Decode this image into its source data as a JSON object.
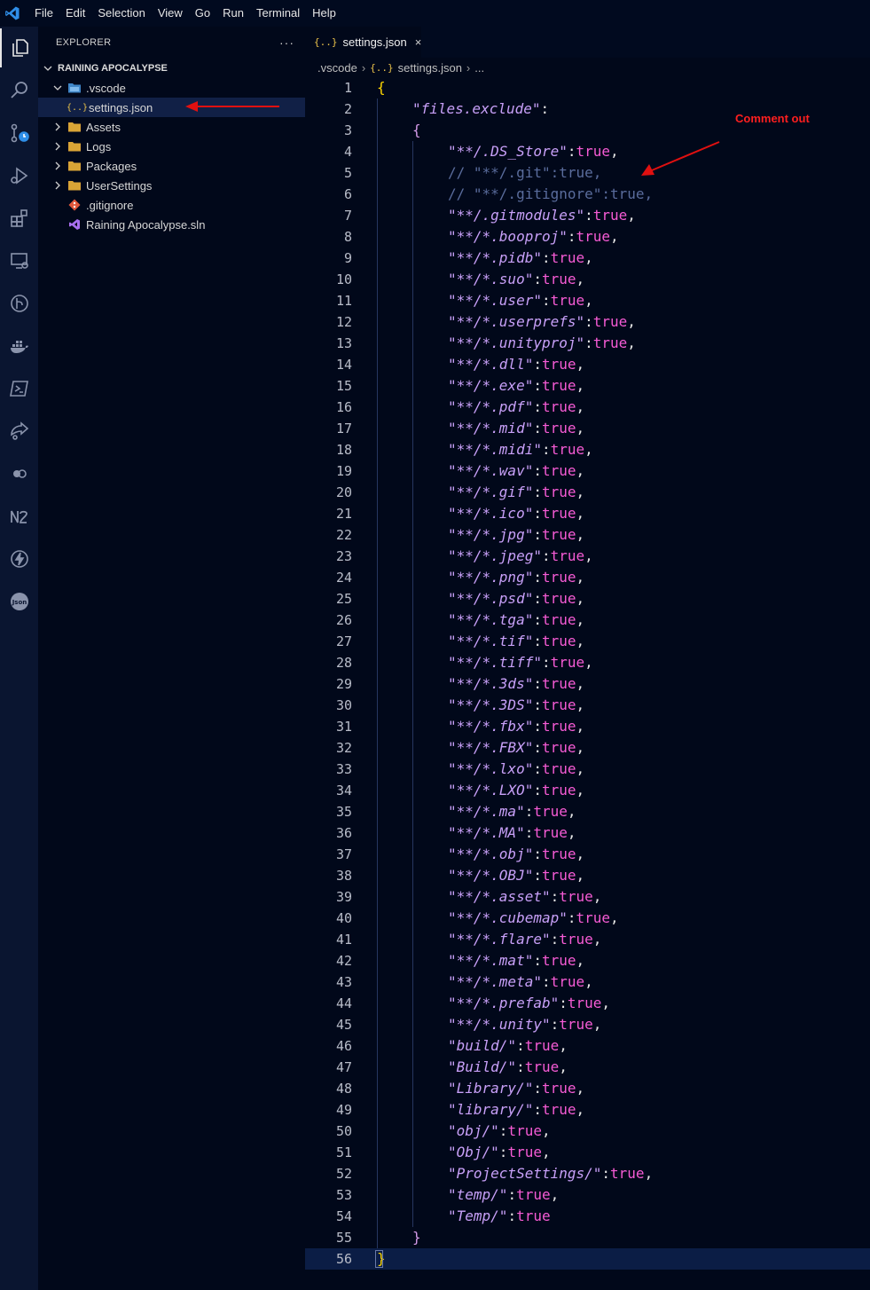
{
  "menu": [
    "File",
    "Edit",
    "Selection",
    "View",
    "Go",
    "Run",
    "Terminal",
    "Help"
  ],
  "activity_icons": [
    "explorer-icon",
    "search-icon",
    "source-control-icon",
    "run-debug-icon",
    "extensions-icon",
    "remote-explorer-icon",
    "git-graph-icon",
    "docker-icon",
    "powershell-icon",
    "live-share-icon",
    "toggle-icon",
    "n2-icon",
    "thunder-client-icon",
    "json-icon"
  ],
  "sidebar": {
    "title": "EXPLORER",
    "more": "···",
    "project": "RAINING APOCALYPSE",
    "tree": [
      {
        "label": ".vscode",
        "type": "folder-open",
        "depth": 1
      },
      {
        "label": "settings.json",
        "type": "json",
        "depth": 2,
        "selected": true
      },
      {
        "label": "Assets",
        "type": "folder",
        "depth": 1
      },
      {
        "label": "Logs",
        "type": "folder",
        "depth": 1
      },
      {
        "label": "Packages",
        "type": "folder",
        "depth": 1
      },
      {
        "label": "UserSettings",
        "type": "folder",
        "depth": 1
      },
      {
        "label": ".gitignore",
        "type": "git",
        "depth": 1
      },
      {
        "label": "Raining Apocalypse.sln",
        "type": "sln",
        "depth": 1
      }
    ]
  },
  "tab": {
    "icon": "{..}",
    "label": "settings.json",
    "close": "×"
  },
  "breadcrumb": [
    ".vscode",
    "settings.json",
    "..."
  ],
  "annotation": {
    "label": "Comment out",
    "color": "#ff1f1f"
  },
  "colors": {
    "key": "#c8a0f8",
    "value": "#f65bd5",
    "comment": "#5a6c9c",
    "bracket": "#ffd700",
    "background": "#01081a"
  },
  "editor": {
    "current_line": 56,
    "lines": [
      {
        "t": "obrace",
        "text": "{"
      },
      {
        "t": "key",
        "indent": 1,
        "key": "\"files.exclude\"",
        "suffix": ":"
      },
      {
        "t": "brace",
        "indent": 1,
        "text": "{"
      },
      {
        "t": "entry",
        "key": "\"**/.DS_Store\"",
        "val": "true",
        "comma": ","
      },
      {
        "t": "comment",
        "text": "// \"**/.git\":true,"
      },
      {
        "t": "comment",
        "text": "// \"**/.gitignore\":true,"
      },
      {
        "t": "entry",
        "key": "\"**/.gitmodules\"",
        "val": "true",
        "comma": ","
      },
      {
        "t": "entry",
        "key": "\"**/*.booproj\"",
        "val": "true",
        "comma": ","
      },
      {
        "t": "entry",
        "key": "\"**/*.pidb\"",
        "val": "true",
        "comma": ","
      },
      {
        "t": "entry",
        "key": "\"**/*.suo\"",
        "val": "true",
        "comma": ","
      },
      {
        "t": "entry",
        "key": "\"**/*.user\"",
        "val": "true",
        "comma": ","
      },
      {
        "t": "entry",
        "key": "\"**/*.userprefs\"",
        "val": "true",
        "comma": ","
      },
      {
        "t": "entry",
        "key": "\"**/*.unityproj\"",
        "val": "true",
        "comma": ","
      },
      {
        "t": "entry",
        "key": "\"**/*.dll\"",
        "val": "true",
        "comma": ","
      },
      {
        "t": "entry",
        "key": "\"**/*.exe\"",
        "val": "true",
        "comma": ","
      },
      {
        "t": "entry",
        "key": "\"**/*.pdf\"",
        "val": "true",
        "comma": ","
      },
      {
        "t": "entry",
        "key": "\"**/*.mid\"",
        "val": "true",
        "comma": ","
      },
      {
        "t": "entry",
        "key": "\"**/*.midi\"",
        "val": "true",
        "comma": ","
      },
      {
        "t": "entry",
        "key": "\"**/*.wav\"",
        "val": "true",
        "comma": ","
      },
      {
        "t": "entry",
        "key": "\"**/*.gif\"",
        "val": "true",
        "comma": ","
      },
      {
        "t": "entry",
        "key": "\"**/*.ico\"",
        "val": "true",
        "comma": ","
      },
      {
        "t": "entry",
        "key": "\"**/*.jpg\"",
        "val": "true",
        "comma": ","
      },
      {
        "t": "entry",
        "key": "\"**/*.jpeg\"",
        "val": "true",
        "comma": ","
      },
      {
        "t": "entry",
        "key": "\"**/*.png\"",
        "val": "true",
        "comma": ","
      },
      {
        "t": "entry",
        "key": "\"**/*.psd\"",
        "val": "true",
        "comma": ","
      },
      {
        "t": "entry",
        "key": "\"**/*.tga\"",
        "val": "true",
        "comma": ","
      },
      {
        "t": "entry",
        "key": "\"**/*.tif\"",
        "val": "true",
        "comma": ","
      },
      {
        "t": "entry",
        "key": "\"**/*.tiff\"",
        "val": "true",
        "comma": ","
      },
      {
        "t": "entry",
        "key": "\"**/*.3ds\"",
        "val": "true",
        "comma": ","
      },
      {
        "t": "entry",
        "key": "\"**/*.3DS\"",
        "val": "true",
        "comma": ","
      },
      {
        "t": "entry",
        "key": "\"**/*.fbx\"",
        "val": "true",
        "comma": ","
      },
      {
        "t": "entry",
        "key": "\"**/*.FBX\"",
        "val": "true",
        "comma": ","
      },
      {
        "t": "entry",
        "key": "\"**/*.lxo\"",
        "val": "true",
        "comma": ","
      },
      {
        "t": "entry",
        "key": "\"**/*.LXO\"",
        "val": "true",
        "comma": ","
      },
      {
        "t": "entry",
        "key": "\"**/*.ma\"",
        "val": "true",
        "comma": ","
      },
      {
        "t": "entry",
        "key": "\"**/*.MA\"",
        "val": "true",
        "comma": ","
      },
      {
        "t": "entry",
        "key": "\"**/*.obj\"",
        "val": "true",
        "comma": ","
      },
      {
        "t": "entry",
        "key": "\"**/*.OBJ\"",
        "val": "true",
        "comma": ","
      },
      {
        "t": "entry",
        "key": "\"**/*.asset\"",
        "val": "true",
        "comma": ","
      },
      {
        "t": "entry",
        "key": "\"**/*.cubemap\"",
        "val": "true",
        "comma": ","
      },
      {
        "t": "entry",
        "key": "\"**/*.flare\"",
        "val": "true",
        "comma": ","
      },
      {
        "t": "entry",
        "key": "\"**/*.mat\"",
        "val": "true",
        "comma": ","
      },
      {
        "t": "entry",
        "key": "\"**/*.meta\"",
        "val": "true",
        "comma": ","
      },
      {
        "t": "entry",
        "key": "\"**/*.prefab\"",
        "val": "true",
        "comma": ","
      },
      {
        "t": "entry",
        "key": "\"**/*.unity\"",
        "val": "true",
        "comma": ","
      },
      {
        "t": "entry",
        "key": "\"build/\"",
        "val": "true",
        "comma": ","
      },
      {
        "t": "entry",
        "key": "\"Build/\"",
        "val": "true",
        "comma": ","
      },
      {
        "t": "entry",
        "key": "\"Library/\"",
        "val": "true",
        "comma": ","
      },
      {
        "t": "entry",
        "key": "\"library/\"",
        "val": "true",
        "comma": ","
      },
      {
        "t": "entry",
        "key": "\"obj/\"",
        "val": "true",
        "comma": ","
      },
      {
        "t": "entry",
        "key": "\"Obj/\"",
        "val": "true",
        "comma": ","
      },
      {
        "t": "entry",
        "key": "\"ProjectSettings/\"",
        "val": "true",
        "comma": ","
      },
      {
        "t": "entry",
        "key": "\"temp/\"",
        "val": "true",
        "comma": ","
      },
      {
        "t": "entry",
        "key": "\"Temp/\"",
        "val": "true",
        "comma": ""
      },
      {
        "t": "brace",
        "indent": 1,
        "text": "}"
      },
      {
        "t": "obrace",
        "text": "}"
      }
    ]
  }
}
